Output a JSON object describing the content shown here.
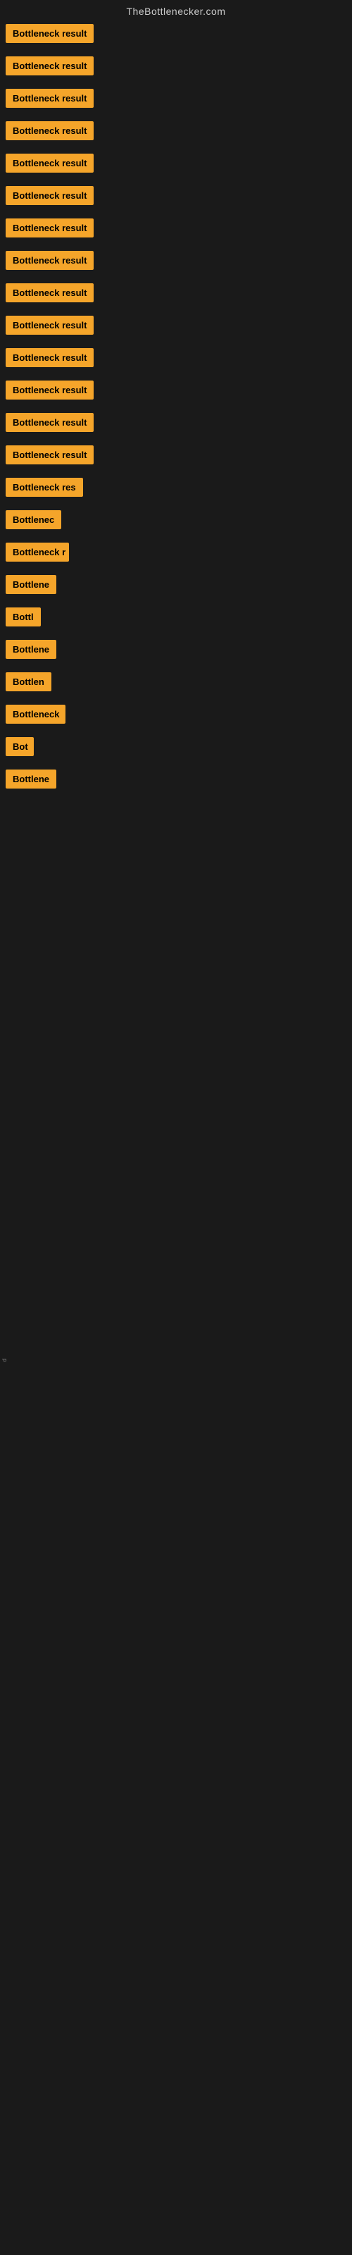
{
  "header": {
    "title": "TheBottlenecker.com"
  },
  "items": [
    {
      "label": "Bottleneck result",
      "width": 130
    },
    {
      "label": "Bottleneck result",
      "width": 130
    },
    {
      "label": "Bottleneck result",
      "width": 130
    },
    {
      "label": "Bottleneck result",
      "width": 130
    },
    {
      "label": "Bottleneck result",
      "width": 130
    },
    {
      "label": "Bottleneck result",
      "width": 130
    },
    {
      "label": "Bottleneck result",
      "width": 130
    },
    {
      "label": "Bottleneck result",
      "width": 130
    },
    {
      "label": "Bottleneck result",
      "width": 130
    },
    {
      "label": "Bottleneck result",
      "width": 130
    },
    {
      "label": "Bottleneck result",
      "width": 130
    },
    {
      "label": "Bottleneck result",
      "width": 130
    },
    {
      "label": "Bottleneck result",
      "width": 130
    },
    {
      "label": "Bottleneck result",
      "width": 130
    },
    {
      "label": "Bottleneck res",
      "width": 110
    },
    {
      "label": "Bottlenec",
      "width": 80
    },
    {
      "label": "Bottleneck r",
      "width": 90
    },
    {
      "label": "Bottlene",
      "width": 75
    },
    {
      "label": "Bottl",
      "width": 55
    },
    {
      "label": "Bottlene",
      "width": 75
    },
    {
      "label": "Bottlen",
      "width": 65
    },
    {
      "label": "Bottleneck",
      "width": 85
    },
    {
      "label": "Bot",
      "width": 40
    },
    {
      "label": "Bottlene",
      "width": 75
    }
  ],
  "bottom_label": "d"
}
